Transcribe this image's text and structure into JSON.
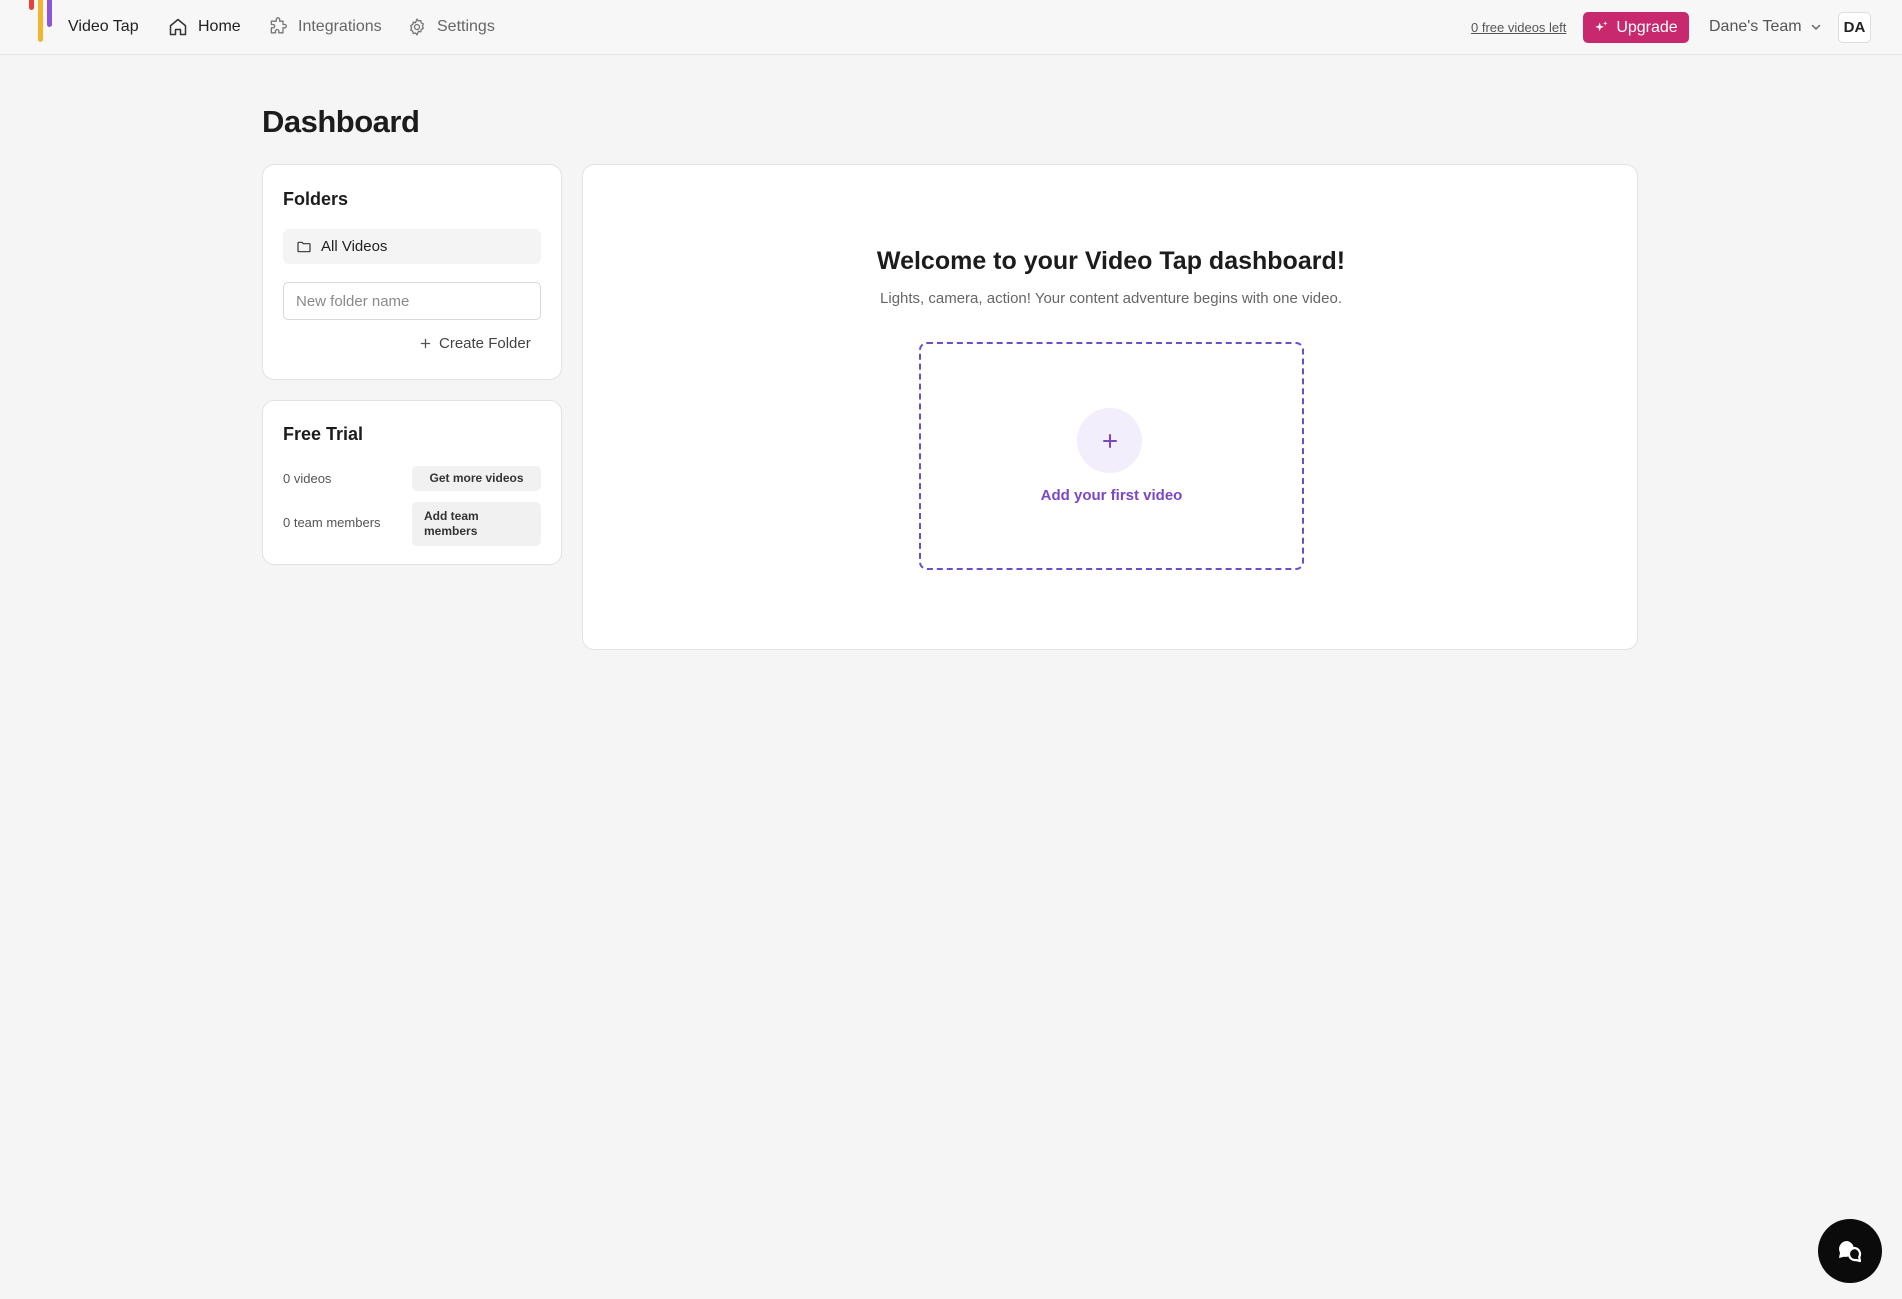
{
  "app": {
    "brand": "Video Tap",
    "logo_colors": [
      "#e8413b",
      "#f2b52e",
      "#8e55d6"
    ]
  },
  "nav": {
    "items": [
      {
        "label": "Home",
        "icon": "home-icon",
        "active": true
      },
      {
        "label": "Integrations",
        "icon": "puzzle-icon",
        "active": false
      },
      {
        "label": "Settings",
        "icon": "gear-icon",
        "active": false
      }
    ]
  },
  "header": {
    "free_videos_left": "0 free videos left",
    "upgrade_label": "Upgrade",
    "upgrade_icon": "sparkle-icon",
    "team_label": "Dane's Team",
    "team_icon": "chevron-down-icon",
    "avatar_initials": "DA"
  },
  "page": {
    "title": "Dashboard"
  },
  "folders": {
    "title": "Folders",
    "all_videos_label": "All Videos",
    "folder_icon": "folder-icon",
    "new_folder_placeholder": "New folder name",
    "create_folder_label": "Create Folder"
  },
  "free_trial": {
    "title": "Free Trial",
    "videos_label": "0 videos",
    "get_more_label": "Get more videos",
    "team_members_label": "0 team members",
    "add_team_line1": "Add team",
    "add_team_line2": "members"
  },
  "welcome": {
    "title": "Welcome to your Video Tap dashboard!",
    "subtitle": "Lights, camera, action! Your content adventure begins with one video.",
    "add_video_label": "Add your first video"
  },
  "colors": {
    "accent_pink": "#c8286d",
    "accent_purple": "#7b47c7",
    "dropzone_border": "#6a4fc9"
  },
  "chat": {
    "icon": "chat-bubble-icon"
  }
}
